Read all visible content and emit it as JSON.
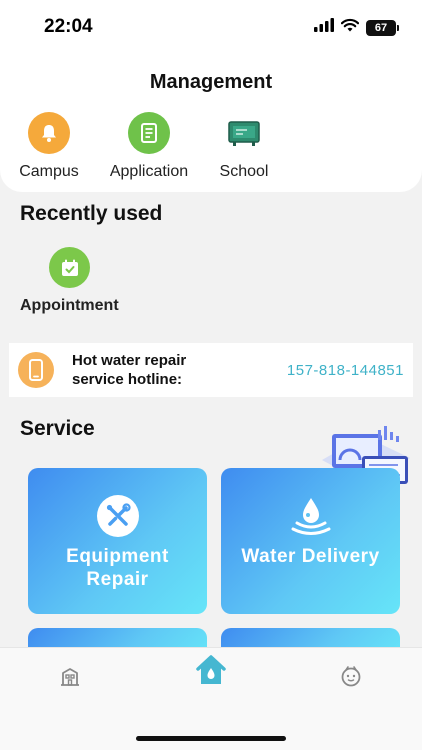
{
  "status_bar": {
    "time": "22:04",
    "battery": "67"
  },
  "management": {
    "title": "Management",
    "items": [
      {
        "label": "Campus",
        "icon": "bell-icon",
        "color": "#f5a93b"
      },
      {
        "label": "Application",
        "icon": "document-icon",
        "color": "#6fc24a"
      },
      {
        "label": "School",
        "icon": "board-icon",
        "color": "#2e8b6e"
      }
    ]
  },
  "recently_used": {
    "title": "Recently used",
    "items": [
      {
        "label": "Appointment",
        "icon": "calendar-check-icon",
        "color": "#7cc84a"
      }
    ]
  },
  "hotline": {
    "text": "Hot water repair service hotline:",
    "phone": "157-818-144851",
    "icon": "phone-icon"
  },
  "service": {
    "title": "Service",
    "cards": [
      {
        "label": "Equipment Repair",
        "icon": "tools-icon"
      },
      {
        "label": "Water Delivery",
        "icon": "water-drop-icon"
      }
    ]
  },
  "tabbar": {
    "tabs": [
      {
        "icon": "building-icon"
      },
      {
        "icon": "home-icon",
        "active": true
      },
      {
        "icon": "face-icon"
      }
    ],
    "active_color": "#45b7d1"
  }
}
